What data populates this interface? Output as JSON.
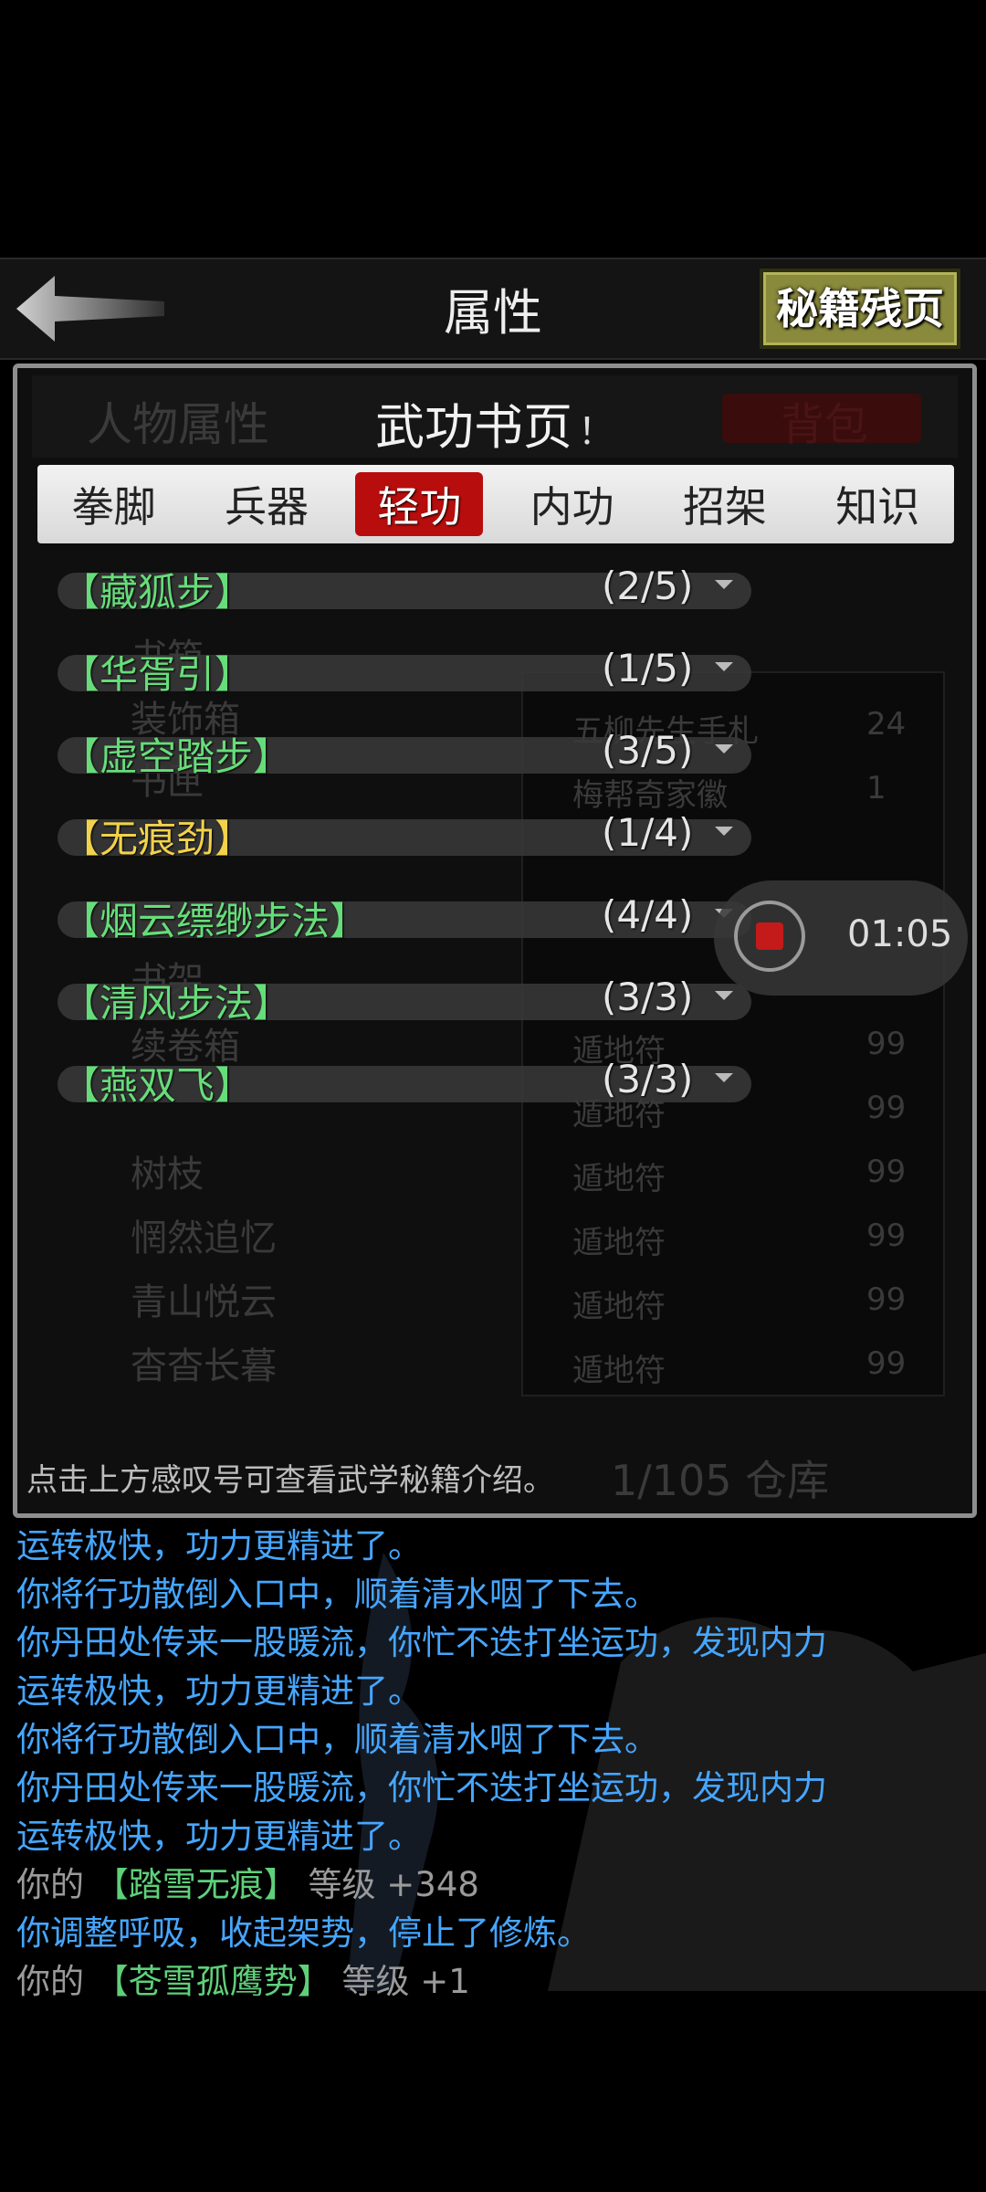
{
  "header": {
    "title": "属性",
    "secret_button": "秘籍残页"
  },
  "panel": {
    "faded_left_tab": "人物属性",
    "faded_right_tab": "背包",
    "title": "武功书页",
    "info_mark": "！",
    "hint": "点击上方感叹号可查看武学秘籍介绍。"
  },
  "tabs": [
    {
      "label": "拳脚",
      "active": false
    },
    {
      "label": "兵器",
      "active": false
    },
    {
      "label": "轻功",
      "active": true
    },
    {
      "label": "内功",
      "active": false
    },
    {
      "label": "招架",
      "active": false
    },
    {
      "label": "知识",
      "active": false
    }
  ],
  "pages": [
    {
      "name": "【藏狐步】",
      "count": "(2/5)"
    },
    {
      "name": "【华胥引】",
      "count": "(1/5)"
    },
    {
      "name": "【虚空踏步】",
      "count": "(3/5)"
    },
    {
      "name": "【无痕劲】",
      "count": "(1/4)"
    },
    {
      "name": "【烟云缥缈步法】",
      "count": "(4/4)"
    },
    {
      "name": "【清风步法】",
      "count": "(3/3)"
    },
    {
      "name": "【燕双飞】",
      "count": "(3/3)"
    }
  ],
  "background_inventory": {
    "left": [
      "书箱",
      "装饰箱",
      "书匣",
      "书架",
      "续卷箱",
      "树枝",
      "惘然追忆",
      "青山悦云",
      "杳杳长暮"
    ],
    "right": [
      {
        "name": "五柳先生手札",
        "qty": "24"
      },
      {
        "name": "梅帮奇家徽",
        "qty": "1"
      },
      {
        "name": "遁地符",
        "qty": "99"
      },
      {
        "name": "遁地符",
        "qty": "99"
      },
      {
        "name": "遁地符",
        "qty": "99"
      },
      {
        "name": "遁地符",
        "qty": "99"
      },
      {
        "name": "遁地符",
        "qty": "99"
      },
      {
        "name": "遁地符",
        "qty": "99"
      }
    ],
    "capacity": "1/105 仓库"
  },
  "recording": {
    "time": "01:05"
  },
  "log": [
    {
      "color": "blue",
      "text": "运转极快，功力更精进了。"
    },
    {
      "color": "blue",
      "text": "你将行功散倒入口中，顺着清水咽了下去。"
    },
    {
      "color": "blue",
      "text": "你丹田处传来一股暖流，你忙不迭打坐运功，发现内力"
    },
    {
      "color": "blue",
      "text": "运转极快，功力更精进了。"
    },
    {
      "color": "blue",
      "text": "你将行功散倒入口中，顺着清水咽了下去。"
    },
    {
      "color": "blue",
      "text": "你丹田处传来一股暖流，你忙不迭打坐运功，发现内力"
    },
    {
      "color": "blue",
      "text": "运转极快，功力更精进了。"
    },
    {
      "color": "mixed",
      "prefix": "你的",
      "skill": "【踏雪无痕】",
      "suffix": "等级 +348"
    },
    {
      "color": "blue",
      "text": "你调整呼吸，收起架势，停止了修炼。"
    },
    {
      "color": "mixed",
      "prefix": "你的",
      "skill": "【苍雪孤鹰势】",
      "suffix": "等级 +1"
    }
  ]
}
